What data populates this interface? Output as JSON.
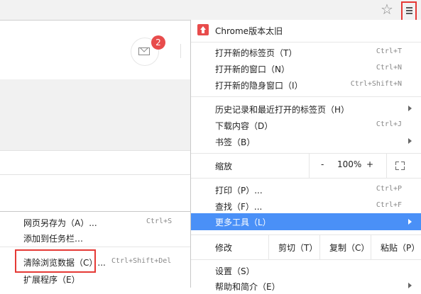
{
  "toolbar": {
    "star_icon": "star-outline-icon",
    "menu_icon": "hamburger-menu-icon"
  },
  "page": {
    "badge_count": "2"
  },
  "submenu": {
    "items": [
      {
        "label": "网页另存为（A）...",
        "shortcut": "Ctrl+S"
      },
      {
        "label": "添加到任务栏…",
        "shortcut": ""
      },
      {
        "label": "清除浏览数据（C）...",
        "shortcut": "Ctrl+Shift+Del"
      },
      {
        "label": "扩展程序（E）",
        "shortcut": ""
      }
    ]
  },
  "menu": {
    "update_label": "Chrome版本太旧",
    "new_tab": {
      "label": "打开新的标签页（T）",
      "shortcut": "Ctrl+T"
    },
    "new_window": {
      "label": "打开新的窗口（N）",
      "shortcut": "Ctrl+N"
    },
    "new_incognito": {
      "label": "打开新的隐身窗口（I）",
      "shortcut": "Ctrl+Shift+N"
    },
    "history": {
      "label": "历史记录和最近打开的标签页（H）"
    },
    "downloads": {
      "label": "下载内容（D）",
      "shortcut": "Ctrl+J"
    },
    "bookmarks": {
      "label": "书签（B）"
    },
    "zoom": {
      "label": "缩放",
      "minus": "-",
      "value": "100%",
      "plus": "+"
    },
    "print": {
      "label": "打印（P）...",
      "shortcut": "Ctrl+P"
    },
    "find": {
      "label": "查找（F）...",
      "shortcut": "Ctrl+F"
    },
    "more_tools": {
      "label": "更多工具（L）"
    },
    "edit": {
      "label": "修改",
      "cut": "剪切（T）",
      "copy": "复制（C）",
      "paste": "粘贴（P）"
    },
    "settings": {
      "label": "设置（S）"
    },
    "help": {
      "label": "帮助和简介（E）"
    }
  },
  "colors": {
    "highlight": "#4a90f7",
    "alert_red": "#e53935",
    "badge": "#e84c4c"
  }
}
